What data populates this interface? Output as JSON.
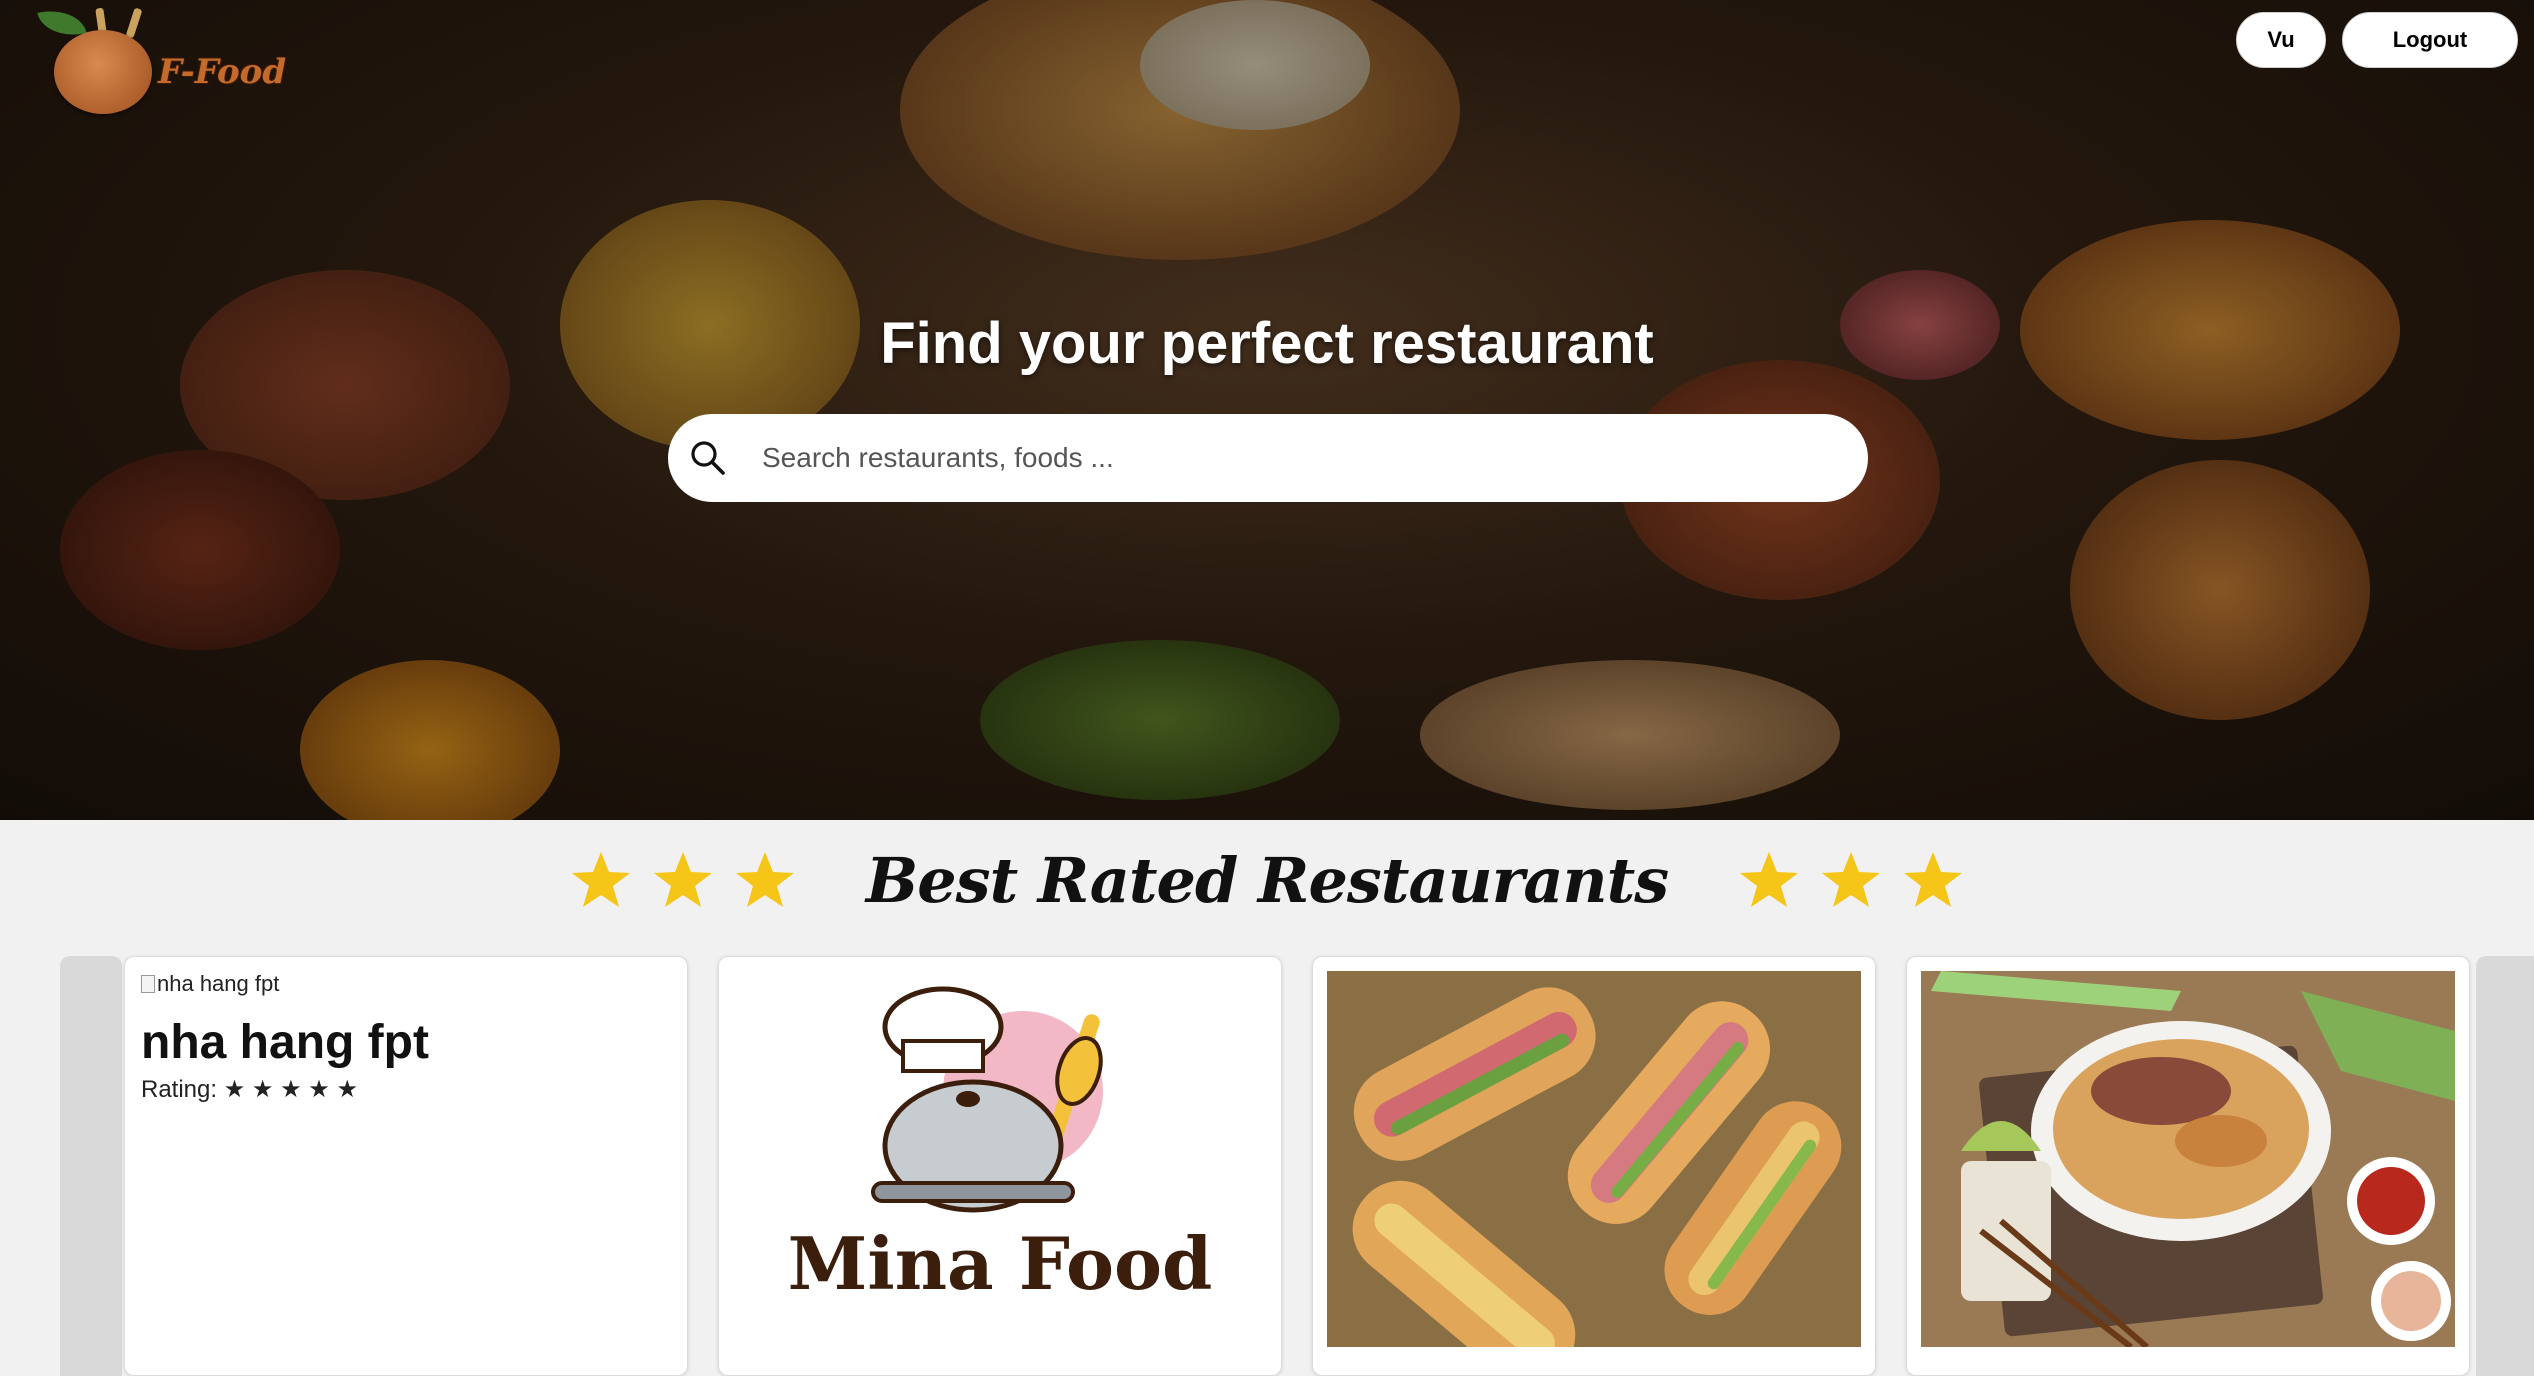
{
  "app": {
    "logo_text": "F-Food"
  },
  "header": {
    "user_label": "Vu",
    "logout_label": "Logout"
  },
  "hero": {
    "title": "Find your perfect restaurant",
    "search_placeholder": "Search restaurants, foods ..."
  },
  "best_rated": {
    "title": "Best Rated Restaurants",
    "star_color": "#f5c518",
    "restaurants": [
      {
        "image_alt": "nha hang fpt",
        "name": "nha hang fpt",
        "rating_label": "Rating: ★ ★ ★ ★ ★"
      },
      {
        "logo_text": "Mina Food"
      },
      {
        "photo": "banh-mi-image"
      },
      {
        "photo": "noodle-soup-image"
      }
    ]
  }
}
